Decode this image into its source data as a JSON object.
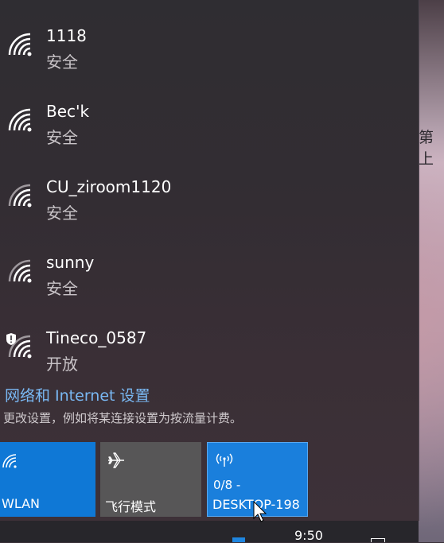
{
  "background": {
    "partial_text": "第上"
  },
  "networks": [
    {
      "ssid": "1118",
      "status": "安全",
      "secured": true
    },
    {
      "ssid": "Bec'k",
      "status": "安全",
      "secured": true
    },
    {
      "ssid": "CU_ziroom1120",
      "status": "安全",
      "secured": true
    },
    {
      "ssid": "sunny",
      "status": "安全",
      "secured": true
    },
    {
      "ssid": "Tineco_0587",
      "status": "开放",
      "secured": false
    }
  ],
  "settings": {
    "link": "网络和 Internet 设置",
    "description": "更改设置，例如将某连接设置为按流量计费。"
  },
  "quick_actions": {
    "wlan": {
      "label": "WLAN",
      "icon": "wifi-icon"
    },
    "airplane": {
      "label": "飞行模式",
      "icon": "airplane-icon"
    },
    "hotspot": {
      "sub": "0/8 -",
      "label": "DESKTOP-198",
      "icon": "hotspot-icon"
    }
  },
  "taskbar": {
    "time": "9:50"
  },
  "colors": {
    "accent": "#0f78d6",
    "link": "#79b8f3",
    "tile_off": "#575657"
  }
}
